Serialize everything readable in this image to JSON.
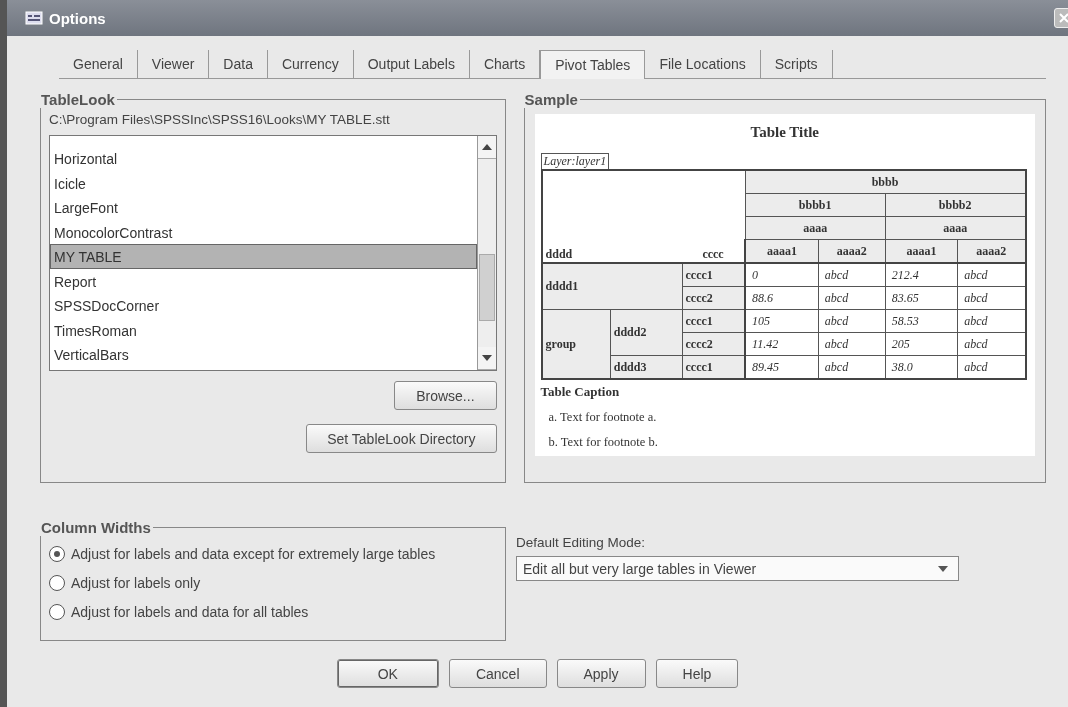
{
  "window": {
    "title": "Options"
  },
  "tabs": [
    {
      "label": "General",
      "selected": false
    },
    {
      "label": "Viewer",
      "selected": false
    },
    {
      "label": "Data",
      "selected": false
    },
    {
      "label": "Currency",
      "selected": false
    },
    {
      "label": "Output Labels",
      "selected": false
    },
    {
      "label": "Charts",
      "selected": false
    },
    {
      "label": "Pivot Tables",
      "selected": true
    },
    {
      "label": "File Locations",
      "selected": false
    },
    {
      "label": "Scripts",
      "selected": false
    }
  ],
  "tablelook": {
    "legend": "TableLook",
    "path": "C:\\Program Files\\SPSSInc\\SPSS16\\Looks\\MY TABLE.stt",
    "items": [
      {
        "label": "Horizontal",
        "selected": false
      },
      {
        "label": "Icicle",
        "selected": false
      },
      {
        "label": "LargeFont",
        "selected": false
      },
      {
        "label": "MonocolorContrast",
        "selected": false
      },
      {
        "label": "MY TABLE",
        "selected": true
      },
      {
        "label": "Report",
        "selected": false
      },
      {
        "label": "SPSSDocCorner",
        "selected": false
      },
      {
        "label": "TimesRoman",
        "selected": false
      },
      {
        "label": "VerticalBars",
        "selected": false
      }
    ],
    "buttons": [
      "Browse...",
      "Set TableLook Directory"
    ]
  },
  "sample": {
    "legend": "Sample",
    "title": "Table Title",
    "layer": "Layer:layer1",
    "column_top": "bbbb",
    "column_groups": [
      {
        "label": "bbbb1",
        "sub": "aaaa",
        "leaves": [
          "aaaa1",
          "aaaa2"
        ]
      },
      {
        "label": "bbbb2",
        "sub": "aaaa",
        "leaves": [
          "aaaa1",
          "aaaa2"
        ]
      }
    ],
    "row_dim_label": "dddd",
    "col_dim_label": "cccc",
    "row_groups": [
      {
        "label": "dddd1",
        "children": [
          {
            "label": "cccc1",
            "values": [
              "0",
              "abcd",
              "212.4",
              "abcd"
            ]
          },
          {
            "label": "cccc2",
            "values": [
              "88.6",
              "abcd",
              "83.65",
              "abcd"
            ]
          }
        ]
      },
      {
        "label": "group",
        "children": [
          {
            "label": "dddd2",
            "children": [
              {
                "label": "cccc1",
                "values": [
                  "105",
                  "abcd",
                  "58.53",
                  "abcd"
                ]
              },
              {
                "label": "cccc2",
                "values": [
                  "11.42",
                  "abcd",
                  "205",
                  "abcd"
                ]
              }
            ]
          },
          {
            "label": "dddd3",
            "children": [
              {
                "label": "cccc1",
                "values": [
                  "89.45",
                  "abcd",
                  "38.0",
                  "abcd"
                ]
              }
            ]
          }
        ]
      }
    ],
    "caption": "Table Caption",
    "footnotes": [
      "a. Text for footnote a.",
      "b. Text for footnote b."
    ]
  },
  "column_widths": {
    "legend": "Column Widths",
    "options": [
      {
        "label": "Adjust for labels and data except for extremely large tables",
        "selected": true
      },
      {
        "label": "Adjust for labels only",
        "selected": false
      },
      {
        "label": "Adjust for labels and data for all tables",
        "selected": false
      }
    ]
  },
  "editing_mode": {
    "label": "Default Editing Mode:",
    "value": "Edit all but very large tables in Viewer"
  },
  "buttons": [
    {
      "label": "OK",
      "default": true
    },
    {
      "label": "Cancel",
      "default": false
    },
    {
      "label": "Apply",
      "default": false
    },
    {
      "label": "Help",
      "default": false
    }
  ]
}
